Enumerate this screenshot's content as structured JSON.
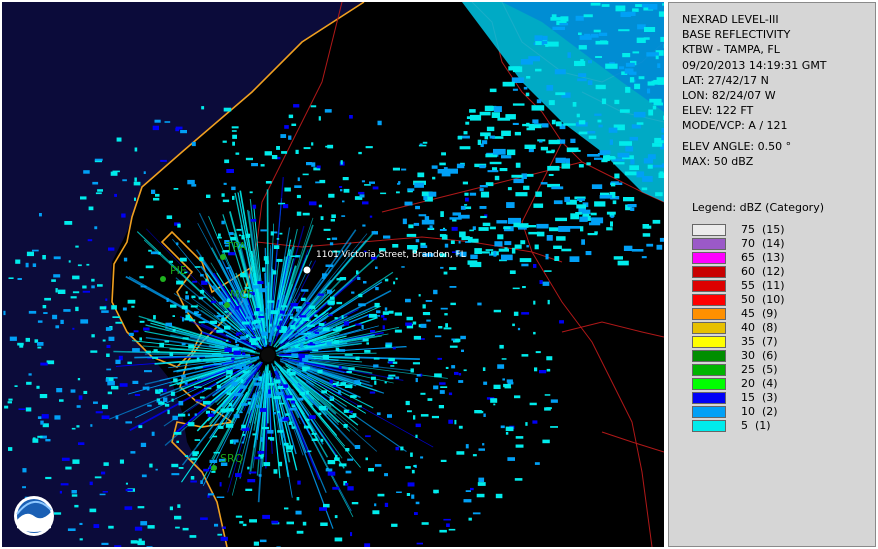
{
  "product": {
    "lines_top": [
      "NEXRAD LEVEL-III",
      "BASE REFLECTIVITY",
      "KTBW - TAMPA, FL",
      "09/20/2013 14:19:31 GMT",
      "LAT: 27/42/17 N",
      "LON: 82/24/07 W",
      "ELEV: 122 FT",
      "MODE/VCP: A / 121"
    ],
    "lines_bottom": [
      "ELEV ANGLE: 0.50 °",
      "MAX: 50 dBZ"
    ]
  },
  "legend": {
    "title": "Legend: dBZ (Category)",
    "rows": [
      {
        "label": "75  (15)",
        "color": "#ebebeb"
      },
      {
        "label": "70  (14)",
        "color": "#9b59c8"
      },
      {
        "label": "65  (13)",
        "color": "#ff00ff"
      },
      {
        "label": "60  (12)",
        "color": "#c80000"
      },
      {
        "label": "55  (11)",
        "color": "#dd0000"
      },
      {
        "label": "50  (10)",
        "color": "#ff0000"
      },
      {
        "label": "45  (9)",
        "color": "#ff9000"
      },
      {
        "label": "40  (8)",
        "color": "#e7c000"
      },
      {
        "label": "35  (7)",
        "color": "#ffff00"
      },
      {
        "label": "30  (6)",
        "color": "#008e00"
      },
      {
        "label": "25  (5)",
        "color": "#00b400"
      },
      {
        "label": "20  (4)",
        "color": "#00ff00"
      },
      {
        "label": "15  (3)",
        "color": "#0000f6"
      },
      {
        "label": "10  (2)",
        "color": "#01a0f6"
      },
      {
        "label": "5  (1)",
        "color": "#00ecec"
      }
    ]
  },
  "map": {
    "stations": [
      "TPA",
      "PIE",
      "MCF",
      "SRQ"
    ],
    "address_label": "1101 Victoria Street, Brandon, FL",
    "colors": {
      "water": "#0b0b3a",
      "land": "#000000",
      "coast": "#f0a020",
      "borders": "#b01818"
    },
    "logo": "noaa-logo"
  }
}
